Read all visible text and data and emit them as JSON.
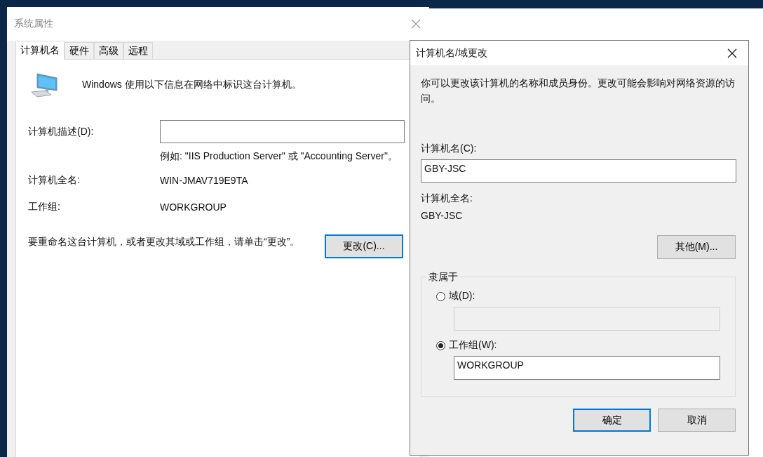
{
  "system_properties": {
    "title": "系统属性",
    "tabs": [
      {
        "label": "计算机名",
        "selected": true
      },
      {
        "label": "硬件",
        "selected": false
      },
      {
        "label": "高级",
        "selected": false
      },
      {
        "label": "远程",
        "selected": false
      }
    ],
    "intro": "Windows 使用以下信息在网络中标识这台计算机。",
    "description_label": "计算机描述(D):",
    "example": "例如: \"IIS Production Server\" 或 \"Accounting Server\"。",
    "full_name_label": "计算机全名:",
    "full_name": "WIN-JMAV719E9TA",
    "workgroup_label": "工作组:",
    "workgroup": "WORKGROUP",
    "rename_text": "要重命名这台计算机，或者更改其域或工作组，请单击“更改”。",
    "change_button": {
      "label": "更改(C)...",
      "focused": true
    }
  },
  "rename_dialog": {
    "title": "计算机名/域更改",
    "message": "你可以更改该计算机的名称和成员身份。更改可能会影响对网络资源的访问。",
    "computer_name_label": "计算机名(C):",
    "computer_name": "GBY-JSC",
    "full_name_label": "计算机全名:",
    "full_name": "GBY-JSC",
    "more_button": "其他(M)...",
    "member_of": {
      "legend": "隶属于",
      "options": [
        {
          "label": "域(D):",
          "selected": false
        },
        {
          "label": "工作组(W):",
          "selected": true,
          "value": "WORKGROUP"
        }
      ]
    },
    "buttons": [
      {
        "label": "确定",
        "focused": true
      },
      {
        "label": "取消",
        "focused": false
      }
    ]
  }
}
